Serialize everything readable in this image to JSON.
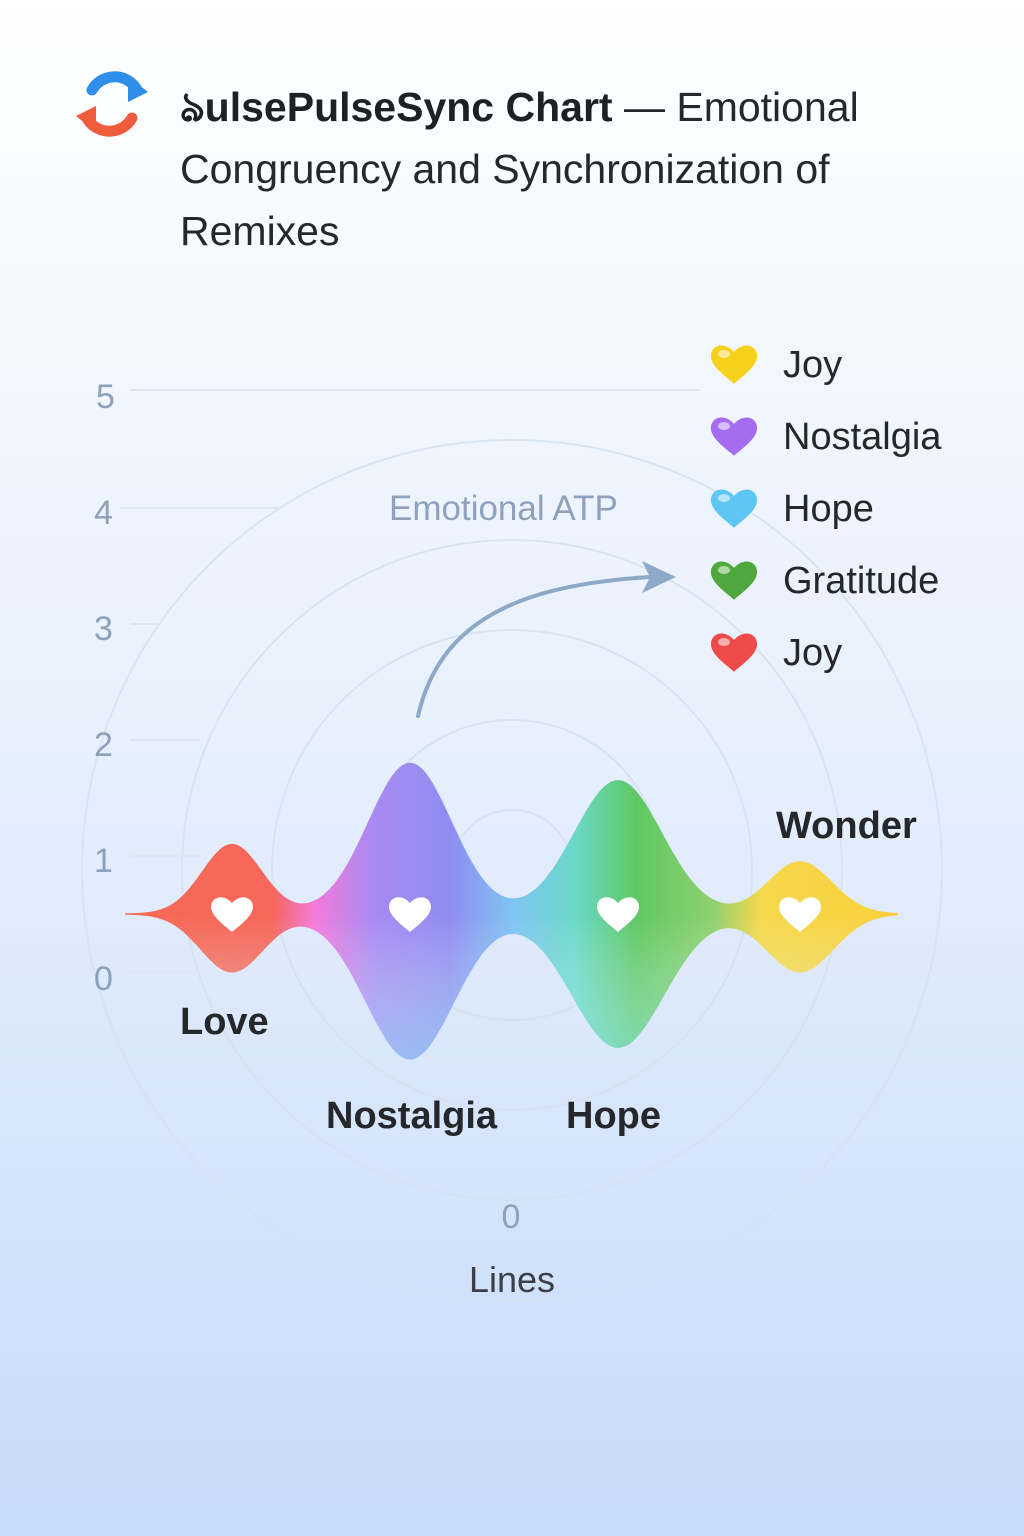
{
  "header": {
    "title_bold": "ঌulsePulseSync Chart",
    "title_rest": " — Emotional Congruency and Synchronization of Remixes"
  },
  "icons": {
    "logo": "sync-arrows-icon",
    "peak_marker": "heart-icon"
  },
  "colors": {
    "love": "#f5664f",
    "pink_blend": "#f37ad9",
    "nostalgia": "#8f8cf2",
    "nostalgia_low": "#7fb6f6",
    "hope_high": "#5cbc4e",
    "hope_low": "#6edcec",
    "wonder": "#f9d44a",
    "axis_text": "#8da1bb",
    "arrow": "#8ea8c8"
  },
  "annotation": {
    "text": "Emotional ATP"
  },
  "chart_data": {
    "type": "area",
    "title": "ঌulsePulseSync Chart — Emotional Congruency and Synchronization of Remixes",
    "xlabel": "Lines",
    "x_tick": "0",
    "ylim": [
      0,
      5
    ],
    "y_ticks": [
      "0",
      "1",
      "2",
      "3",
      "4",
      "5"
    ],
    "baseline": 0.5,
    "peaks": [
      {
        "label": "Love",
        "upper": 1.1,
        "lower": 0.0,
        "color": "#f5664f"
      },
      {
        "label": "Nostalgia",
        "upper": 1.8,
        "lower": -0.75,
        "color": "#8f8cf2"
      },
      {
        "label": "Hope",
        "upper": 1.65,
        "lower": -0.65,
        "color": "#5cbc4e"
      },
      {
        "label": "Wonder",
        "upper": 0.95,
        "lower": 0.0,
        "color": "#f9d44a"
      }
    ],
    "legend": [
      {
        "label": "Joy",
        "color": "#f7d21c"
      },
      {
        "label": "Nostalgia",
        "color": "#a56cf0"
      },
      {
        "label": "Hope",
        "color": "#5ec6f2"
      },
      {
        "label": "Gratitude",
        "color": "#4fa83d"
      },
      {
        "label": "Joy",
        "color": "#ef4a4a"
      }
    ]
  }
}
